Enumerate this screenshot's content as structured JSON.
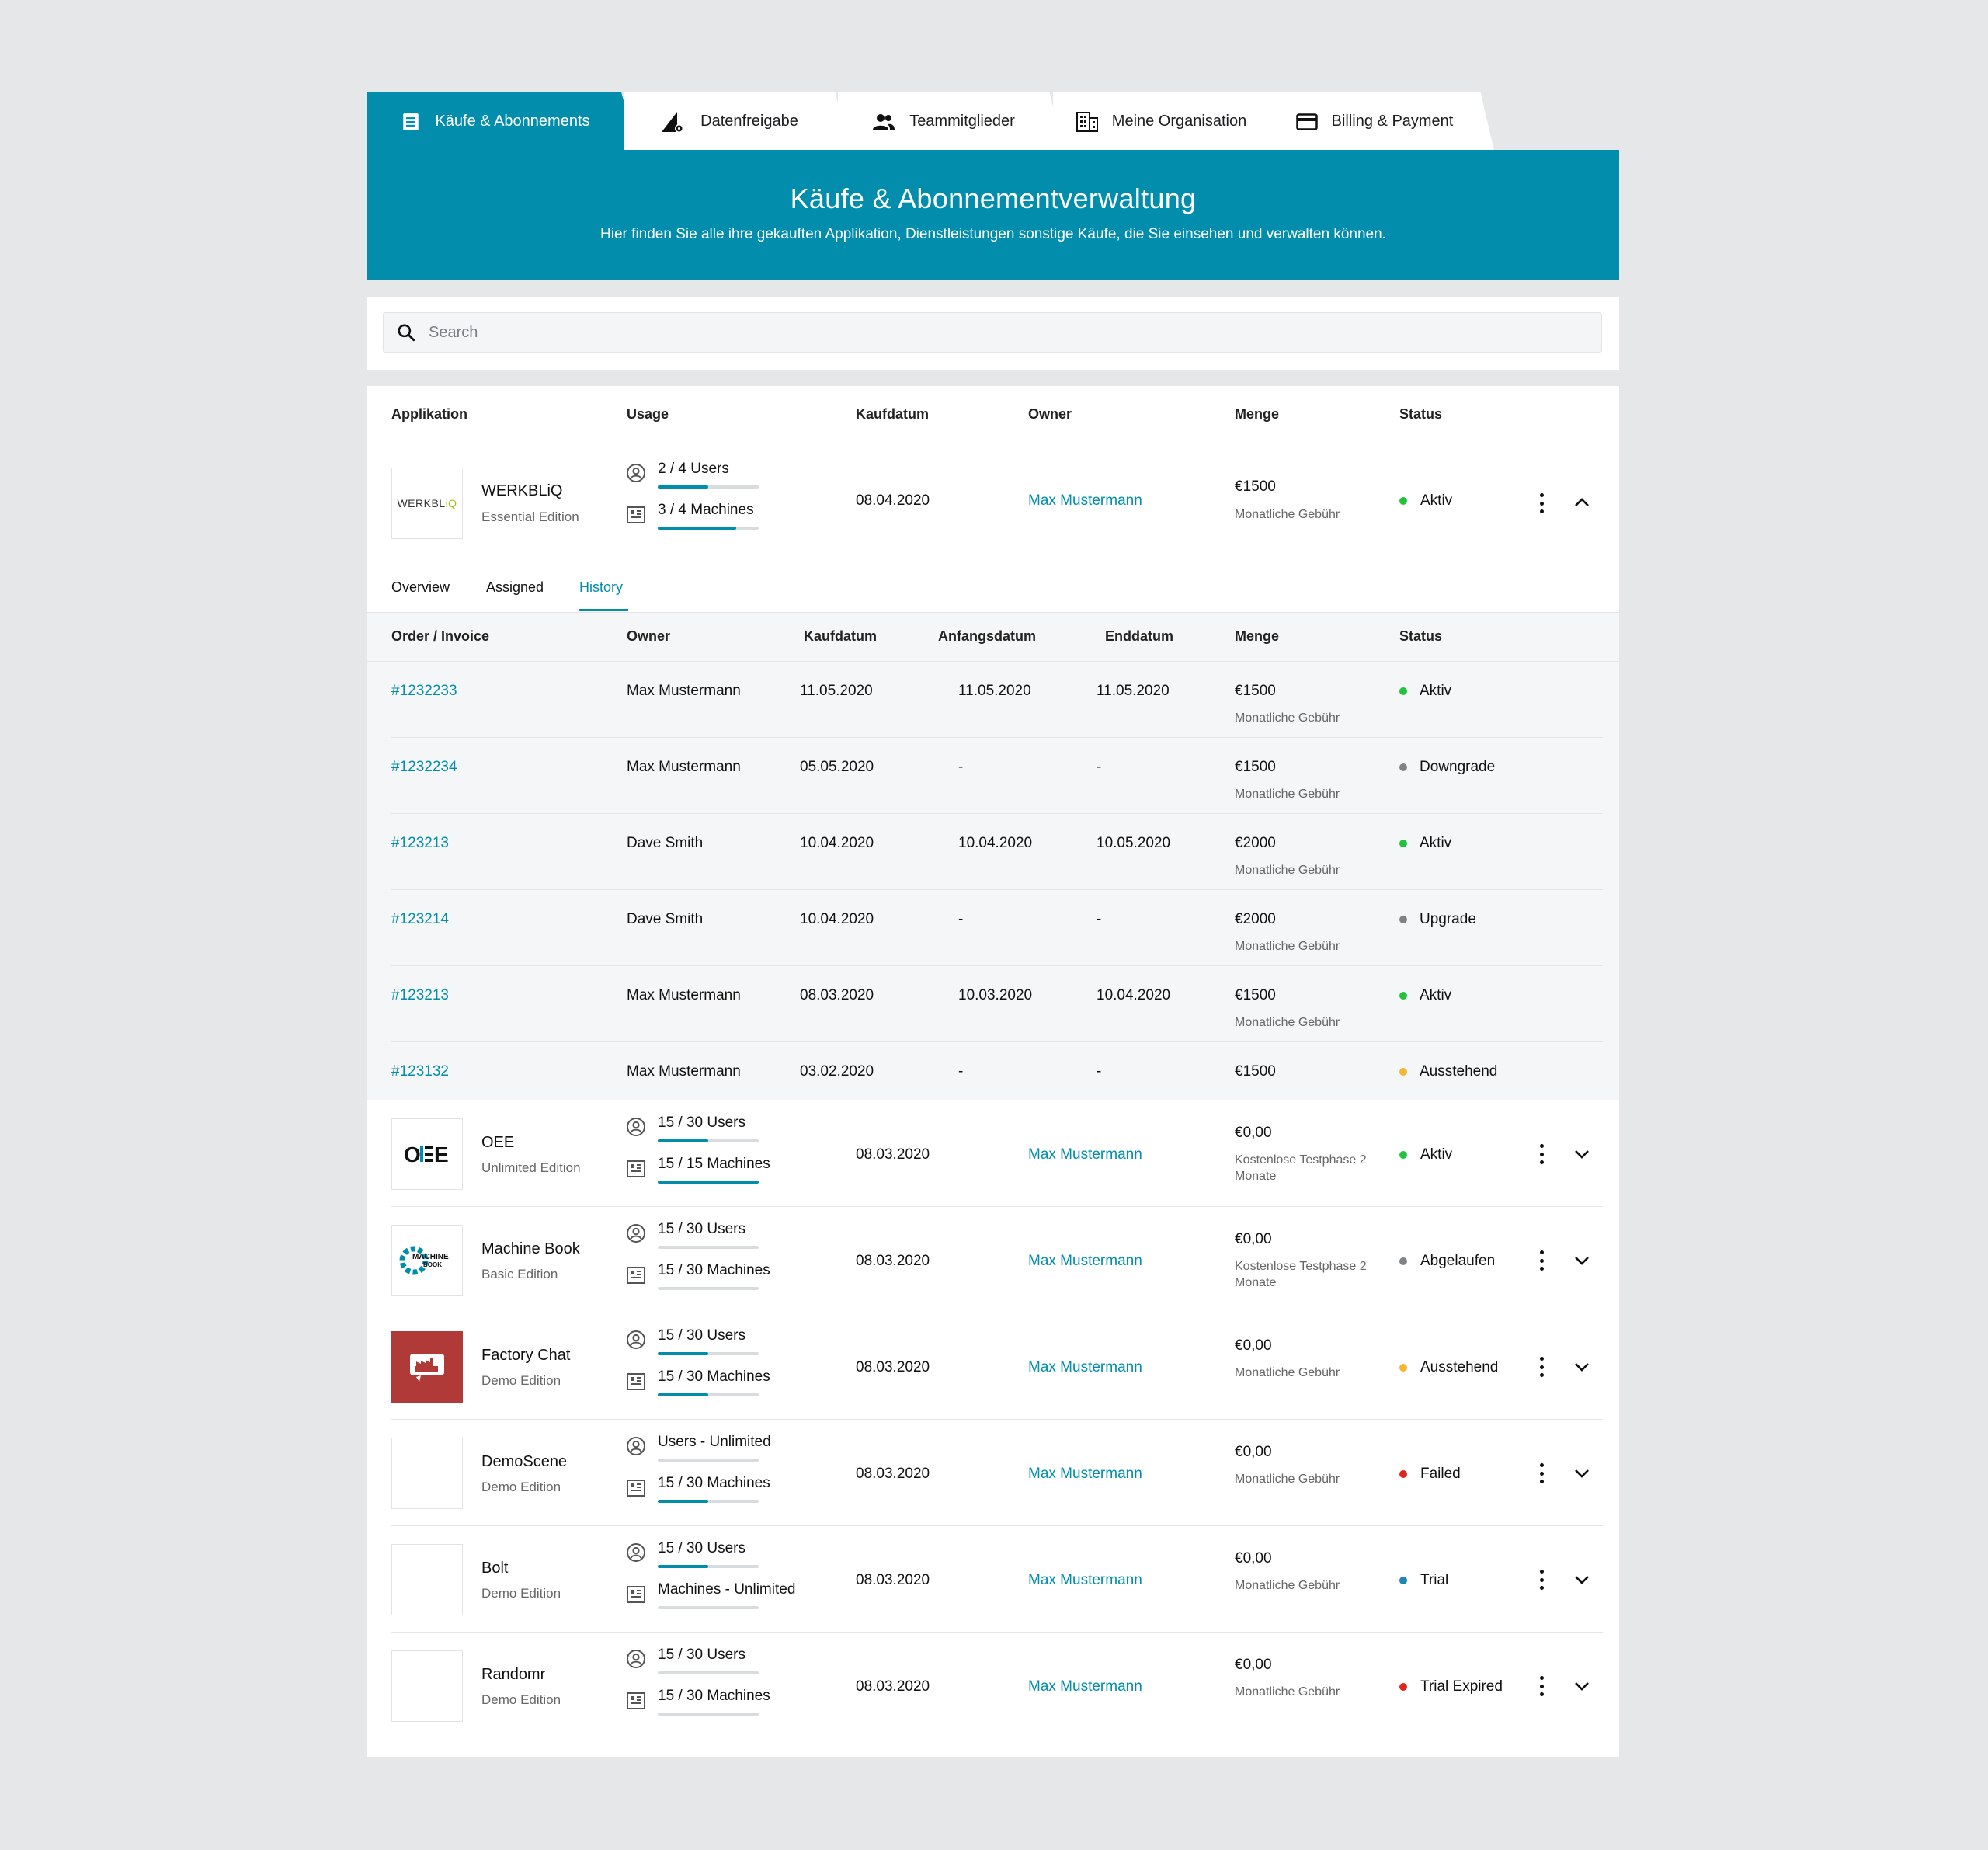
{
  "tabs": [
    {
      "label": "Käufe & Abonnements",
      "icon": "list-document-icon",
      "active": true
    },
    {
      "label": "Datenfreigabe",
      "icon": "signal-gear-icon",
      "active": false
    },
    {
      "label": "Teammitglieder",
      "icon": "team-icon",
      "active": false
    },
    {
      "label": "Meine Organisation",
      "icon": "building-icon",
      "active": false
    },
    {
      "label": "Billing & Payment",
      "icon": "credit-card-icon",
      "active": false
    }
  ],
  "header": {
    "title": "Käufe & Abonnementverwaltung",
    "subtitle": "Hier finden Sie alle ihre gekauften Applikation, Dienstleistungen sonstige Käufe, die Sie einsehen und verwalten können."
  },
  "search": {
    "placeholder": "Search",
    "value": ""
  },
  "columns": {
    "app": "Applikation",
    "usage": "Usage",
    "date": "Kaufdatum",
    "owner": "Owner",
    "amount": "Menge",
    "status": "Status"
  },
  "colors": {
    "accent": "#018dab",
    "green": "#22c33c",
    "gray": "#808385",
    "yellow": "#f5b731",
    "red": "#e0261c",
    "blue": "#1f86b8"
  },
  "rows": [
    {
      "name": "WERKBLiQ",
      "edition": "Essential Edition",
      "logo": "werkbliq-logo",
      "logo_text": "WERKBLiQ",
      "users": "2 / 4 Users",
      "users_pct": 50,
      "machines": "3 / 4 Machines",
      "machines_pct": 78,
      "date": "08.04.2020",
      "owner": "Max Mustermann",
      "amount": "€1500",
      "amount_sub": "Monatliche Gebühr",
      "status": "Aktiv",
      "status_color": "#22c33c",
      "expanded": true
    },
    {
      "name": "OEE",
      "edition": "Unlimited Edition",
      "logo": "oee-logo",
      "logo_text": "OEE",
      "users": "15 / 30 Users",
      "users_pct": 50,
      "machines": "15 / 15 Machines",
      "machines_pct": 100,
      "date": "08.03.2020",
      "owner": "Max Mustermann",
      "amount": "€0,00",
      "amount_sub": "Kostenlose Testphase 2 Monate",
      "status": "Aktiv",
      "status_color": "#22c33c",
      "expanded": false
    },
    {
      "name": "Machine Book",
      "edition": "Basic Edition",
      "logo": "machine-book-logo",
      "logo_text": "MACHINE BOOK",
      "users": "15 / 30 Users",
      "users_pct": 0,
      "machines": "15 / 30 Machines",
      "machines_pct": 0,
      "date": "08.03.2020",
      "owner": "Max Mustermann",
      "amount": "€0,00",
      "amount_sub": "Kostenlose Testphase 2 Monate",
      "status": "Abgelaufen",
      "status_color": "#808385",
      "expanded": false
    },
    {
      "name": "Factory Chat",
      "edition": "Demo Edition",
      "logo": "factory-chat-logo",
      "logo_text": "",
      "users": "15 / 30 Users",
      "users_pct": 50,
      "machines": "15 / 30 Machines",
      "machines_pct": 50,
      "date": "08.03.2020",
      "owner": "Max Mustermann",
      "amount": "€0,00",
      "amount_sub": "Monatliche Gebühr",
      "status": "Ausstehend",
      "status_color": "#f5b731",
      "expanded": false
    },
    {
      "name": "DemoScene",
      "edition": "Demo Edition",
      "logo": "empty-logo",
      "logo_text": "",
      "users": "Users - Unlimited",
      "users_pct": 0,
      "machines": "15 / 30 Machines",
      "machines_pct": 50,
      "date": "08.03.2020",
      "owner": "Max Mustermann",
      "amount": "€0,00",
      "amount_sub": "Monatliche Gebühr",
      "status": "Failed",
      "status_color": "#e0261c",
      "expanded": false
    },
    {
      "name": "Bolt",
      "edition": "Demo Edition",
      "logo": "empty-logo",
      "logo_text": "",
      "users": "15 / 30 Users",
      "users_pct": 50,
      "machines": "Machines - Unlimited",
      "machines_pct": 0,
      "date": "08.03.2020",
      "owner": "Max Mustermann",
      "amount": "€0,00",
      "amount_sub": "Monatliche Gebühr",
      "status": "Trial",
      "status_color": "#1f86b8",
      "expanded": false
    },
    {
      "name": "Randomr",
      "edition": "Demo Edition",
      "logo": "empty-logo",
      "logo_text": "",
      "users": "15 / 30 Users",
      "users_pct": 0,
      "machines": "15 / 30 Machines",
      "machines_pct": 0,
      "date": "08.03.2020",
      "owner": "Max Mustermann",
      "amount": "€0,00",
      "amount_sub": "Monatliche Gebühr",
      "status": "Trial Expired",
      "status_color": "#e0261c",
      "expanded": false
    }
  ],
  "detail": {
    "tabs": [
      {
        "label": "Overview",
        "active": false
      },
      {
        "label": "Assigned",
        "active": false
      },
      {
        "label": "History",
        "active": true
      }
    ],
    "columns": {
      "order": "Order / Invoice",
      "owner": "Owner",
      "date": "Kaufdatum",
      "start": "Anfangsdatum",
      "end": "Enddatum",
      "amount": "Menge",
      "status": "Status"
    },
    "history": [
      {
        "order": "#1232233",
        "owner": "Max Mustermann",
        "date": "11.05.2020",
        "start": "11.05.2020",
        "end": "11.05.2020",
        "amount": "€1500",
        "amount_sub": "Monatliche Gebühr",
        "status": "Aktiv",
        "status_color": "#22c33c"
      },
      {
        "order": "#1232234",
        "owner": "Max Mustermann",
        "date": "05.05.2020",
        "start": "-",
        "end": "-",
        "amount": "€1500",
        "amount_sub": "Monatliche Gebühr",
        "status": "Downgrade",
        "status_color": "#808385"
      },
      {
        "order": "#123213",
        "owner": "Dave Smith",
        "date": "10.04.2020",
        "start": "10.04.2020",
        "end": "10.05.2020",
        "amount": "€2000",
        "amount_sub": "Monatliche Gebühr",
        "status": "Aktiv",
        "status_color": "#22c33c"
      },
      {
        "order": "#123214",
        "owner": "Dave Smith",
        "date": "10.04.2020",
        "start": "-",
        "end": "-",
        "amount": "€2000",
        "amount_sub": "Monatliche Gebühr",
        "status": "Upgrade",
        "status_color": "#808385"
      },
      {
        "order": "#123213",
        "owner": "Max Mustermann",
        "date": "08.03.2020",
        "start": "10.03.2020",
        "end": "10.04.2020",
        "amount": "€1500",
        "amount_sub": "Monatliche Gebühr",
        "status": "Aktiv",
        "status_color": "#22c33c"
      },
      {
        "order": "#123132",
        "owner": "Max Mustermann",
        "date": "03.02.2020",
        "start": "-",
        "end": "-",
        "amount": "€1500",
        "amount_sub": "",
        "status": "Ausstehend",
        "status_color": "#f5b731"
      }
    ]
  }
}
